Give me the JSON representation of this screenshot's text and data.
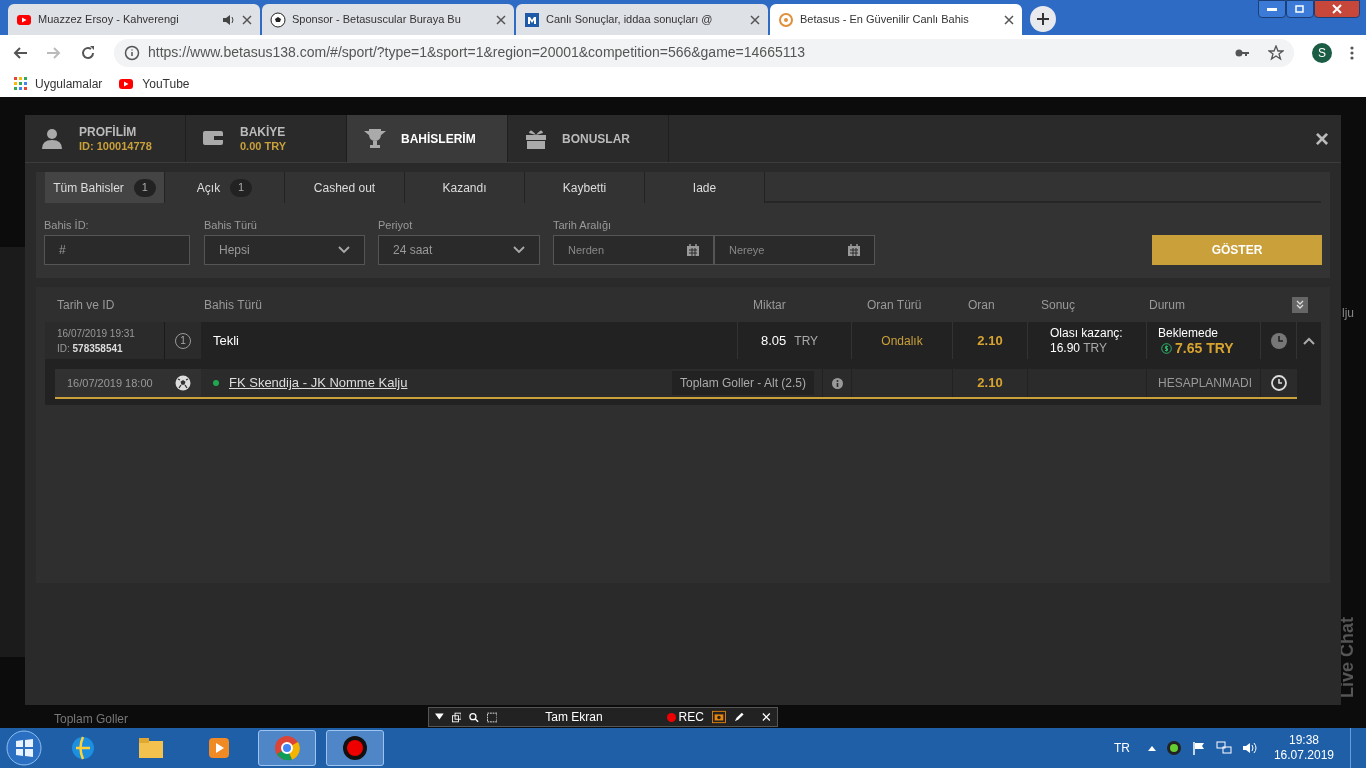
{
  "browser": {
    "tabs": [
      {
        "title": "Muazzez Ersoy - Kahverengi",
        "kind": "youtube",
        "audio": true,
        "selected": false
      },
      {
        "title": "Sponsor - Betasuscular Buraya Bu",
        "kind": "ball",
        "audio": false,
        "selected": false
      },
      {
        "title": "Canlı Sonuçlar, iddaa sonuçları @",
        "kind": "m",
        "audio": false,
        "selected": false
      },
      {
        "title": "Betasus - En Güvenilir Canlı Bahis",
        "kind": "betasus",
        "audio": false,
        "selected": true
      }
    ],
    "url": "https://www.betasus138.com/#/sport/?type=1&sport=1&region=20001&competition=566&game=14665113",
    "profile_initial": "S",
    "bookmarks": [
      {
        "label": "Uygulamalar",
        "kind": "apps"
      },
      {
        "label": "YouTube",
        "kind": "youtube"
      }
    ]
  },
  "background_texts": {
    "bottom": "Toplam Goller",
    "right": "lju",
    "chat": "Live Chat"
  },
  "modal": {
    "tabs": [
      {
        "label": "PROFİLİM",
        "sub": "ID: 100014778",
        "kind": "user",
        "selected": false
      },
      {
        "label": "BAKİYE",
        "sub": "0.00 TRY",
        "kind": "wallet",
        "selected": false
      },
      {
        "label": "BAHİSLERİM",
        "kind": "trophy",
        "selected": true
      },
      {
        "label": "BONUSLAR",
        "kind": "gift",
        "selected": false
      }
    ],
    "close": "×",
    "filter_tabs": [
      {
        "label": "Tüm Bahisler",
        "count": "1",
        "selected": true
      },
      {
        "label": "Açık",
        "count": "1",
        "selected": false
      },
      {
        "label": "Cashed out",
        "selected": false
      },
      {
        "label": "Kazandı",
        "selected": false
      },
      {
        "label": "Kaybetti",
        "selected": false
      },
      {
        "label": "Iade",
        "selected": false
      }
    ],
    "filters": {
      "bet_id": {
        "label": "Bahis İD:",
        "placeholder": "#"
      },
      "bet_type": {
        "label": "Bahis Türü",
        "value": "Hepsi"
      },
      "period": {
        "label": "Periyot",
        "value": "24 saat"
      },
      "date_range": {
        "label": "Tarih Aralığı",
        "from_placeholder": "Nerden",
        "to_placeholder": "Nereye"
      },
      "button": "GÖSTER"
    },
    "table": {
      "columns": [
        "Tarih ve ID",
        "Bahis Türü",
        "Miktar",
        "Oran Türü",
        "Oran",
        "Sonuç",
        "Durum"
      ],
      "rows": [
        {
          "date": "16/07/2019 19:31",
          "id_label": "ID:",
          "id": "578358541",
          "type_number": "1",
          "type": "Tekli",
          "amount": "8.05",
          "currency": "TRY",
          "odds_type": "Ondalık",
          "odds": "2.10",
          "result_label": "Olası kazanç:",
          "result_amount": "16.90",
          "result_currency": "TRY",
          "status": "Beklemede",
          "cashout": "7.65 TRY",
          "expanded": true,
          "selections": [
            {
              "date": "16/07/2019 18:00",
              "live": true,
              "event": "FK Skendija - JK Nomme Kalju",
              "market": "Toplam Goller - Alt (2.5)",
              "odds": "2.10",
              "status": "HESAPLANMADI"
            }
          ]
        }
      ]
    }
  },
  "recorder": {
    "label": "Tam Ekran",
    "rec": "REC"
  },
  "taskbar": {
    "language": "TR",
    "time": "19:38",
    "date": "16.07.2019"
  }
}
